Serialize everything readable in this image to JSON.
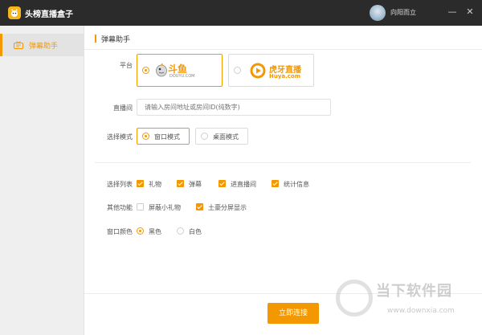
{
  "app": {
    "title": "头榜直播盒子",
    "username": "向阳而立"
  },
  "window_buttons": {
    "minimize": "—",
    "close": "✕"
  },
  "sidebar": {
    "items": [
      {
        "label": "弹幕助手",
        "icon": "barrage-tv-icon",
        "active": true
      }
    ]
  },
  "main": {
    "section_title": "弹幕助手",
    "platform": {
      "label": "平台",
      "options": [
        {
          "name": "斗鱼",
          "sub": "DOUYU.COM",
          "selected": true
        },
        {
          "name": "虎牙直播",
          "sub": "Huya.com",
          "selected": false
        }
      ]
    },
    "room": {
      "label": "直播间",
      "placeholder": "请输入房间地址或房间ID(纯数字)"
    },
    "mode": {
      "label": "选择模式",
      "options": [
        {
          "label": "窗口模式",
          "selected": true
        },
        {
          "label": "桌面模式",
          "selected": false
        }
      ]
    },
    "list": {
      "label": "选择列表",
      "options": [
        {
          "label": "礼物",
          "checked": true
        },
        {
          "label": "弹幕",
          "checked": true
        },
        {
          "label": "进直播间",
          "checked": true
        },
        {
          "label": "统计信息",
          "checked": true
        }
      ]
    },
    "features": {
      "label": "其他功能",
      "options": [
        {
          "label": "屏蔽小礼物",
          "checked": false
        },
        {
          "label": "土豪分屏显示",
          "checked": true
        }
      ]
    },
    "color": {
      "label": "窗口颜色",
      "options": [
        {
          "label": "黑色",
          "selected": true
        },
        {
          "label": "白色",
          "selected": false
        }
      ]
    },
    "connect_button": "立即连接"
  },
  "watermark": {
    "title": "当下软件园",
    "url": "www.downxia.com"
  },
  "colors": {
    "accent": "#f39800",
    "titlebar": "#2b2b2b"
  }
}
